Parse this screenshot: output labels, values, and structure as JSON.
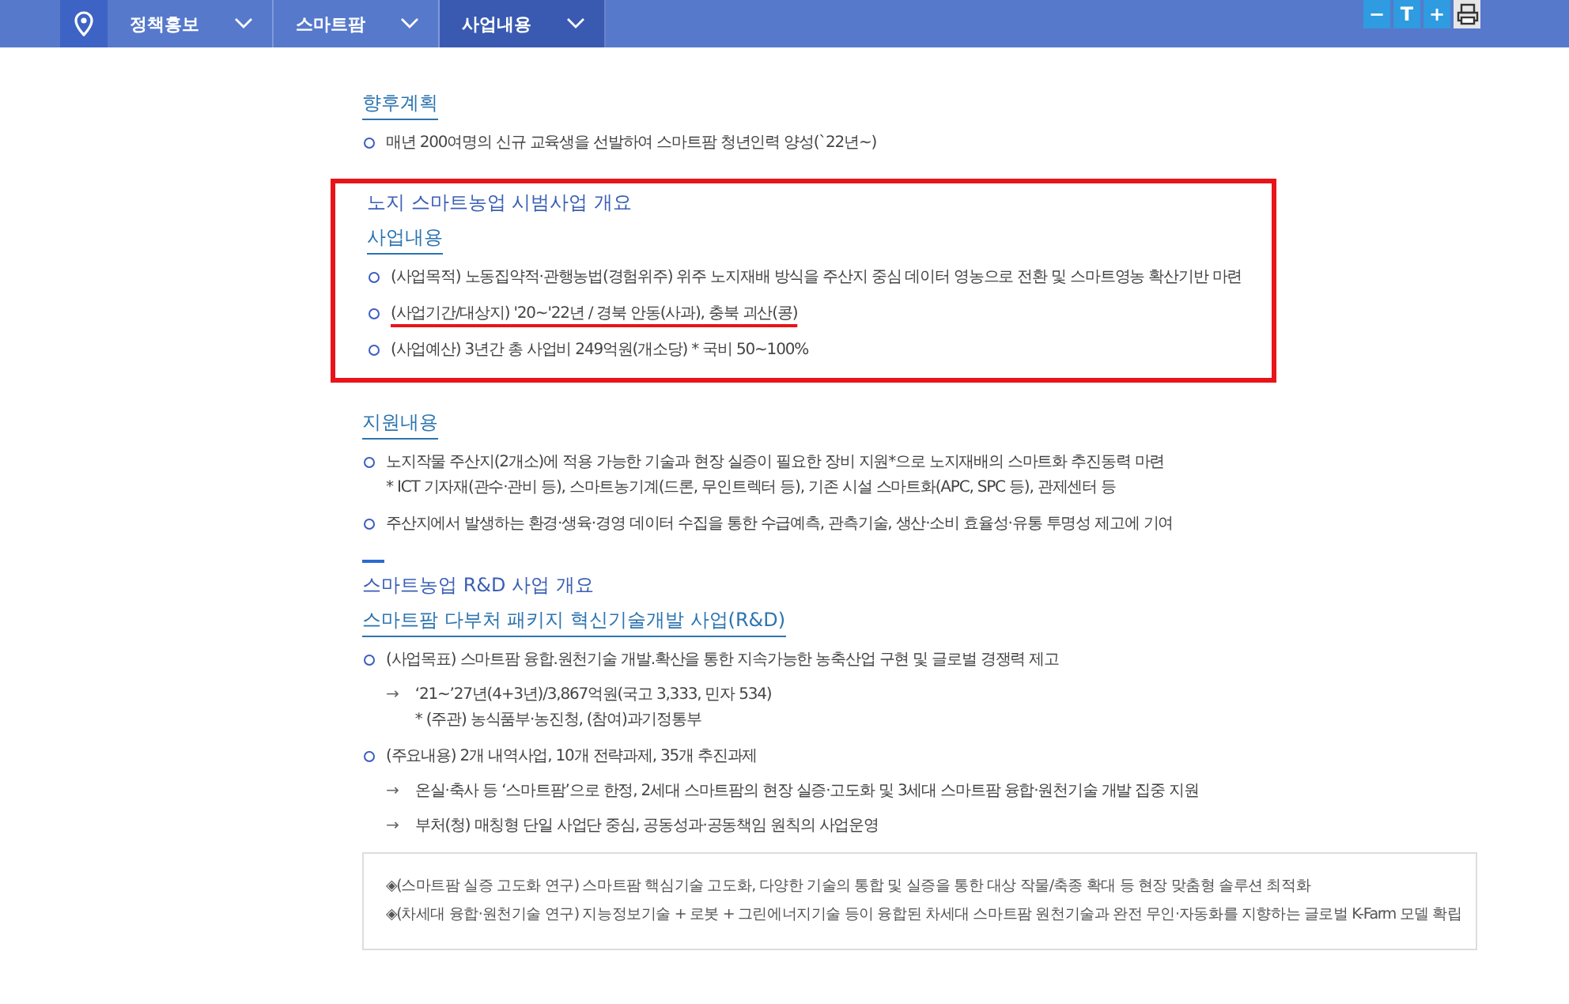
{
  "nav": {
    "items": [
      {
        "label": "정책홍보",
        "selected": false
      },
      {
        "label": "스마트팜",
        "selected": false
      },
      {
        "label": "사업내용",
        "selected": true
      }
    ],
    "tools": [
      {
        "kind": "minus",
        "label": "−"
      },
      {
        "kind": "text",
        "label": "T"
      },
      {
        "kind": "plus",
        "label": "+"
      },
      {
        "kind": "print"
      }
    ]
  },
  "sections": [
    {
      "kind": "plain",
      "heading": "향후계획",
      "items": [
        {
          "text": "매년 200여명의 신규 교육생을 선발하여 스마트팜 청년인력 양성(`22년~)",
          "underlined": false
        }
      ]
    },
    {
      "kind": "highlight",
      "title": "노지 스마트농업 시범사업 개요",
      "heading": "사업내용",
      "items": [
        {
          "text": "(사업목적) 노동집약적·관행농법(경험위주) 위주 노지재배 방식을 주산지 중심 데이터 영농으로 전환 및 스마트영농 확산기반 마련",
          "underlined": false
        },
        {
          "text": "(사업기간/대상지) '20∼'22년 / 경북 안동(사과), 충북 괴산(콩)",
          "underlined": true
        },
        {
          "text": "(사업예산) 3년간 총 사업비 249억원(개소당) * 국비 50∼100%",
          "underlined": false
        }
      ]
    },
    {
      "kind": "plain",
      "heading": "지원내용",
      "items": [
        {
          "text": "노지작물 주산지(2개소)에 적용 가능한 기술과 현장 실증이 필요한 장비 지원*으로 노지재배의 스마트화 추진동력 마련",
          "note": "* ICT 기자재(관수·관비 등), 스마트농기계(드론, 무인트렉터 등), 기존 시설 스마트화(APC, SPC 등), 관제센터 등",
          "underlined": false
        },
        {
          "text": "주산지에서 발생하는 환경·생육·경영 데이터 수집을 통한 수급예측, 관측기술, 생산·소비 효율성·유통 투명성 제고에 기여",
          "underlined": false
        }
      ]
    },
    {
      "kind": "dashed",
      "title": "스마트농업 R&D 사업 개요",
      "heading": "스마트팜 다부처 패키지 혁신기술개발 사업(R&D)",
      "items": [
        {
          "text": "(사업목표) 스마트팜 융합.원천기술 개발.확산을 통한 지속가능한 농축산업 구현 및 글로벌 경쟁력 제고",
          "underlined": false,
          "subs": [
            {
              "mark": "→",
              "text": "‘21~’27년(4+3년)/3,867억원(국고 3,333, 민자 534)",
              "note": "* (주관) 농식품부·농진청, (참여)과기정통부"
            }
          ]
        },
        {
          "text": "(주요내용) 2개 내역사업, 10개 전략과제, 35개 추진과제",
          "underlined": false,
          "subs": [
            {
              "mark": "→",
              "text": "온실·축사 등 ‘스마트팜’으로 한정, 2세대 스마트팜의 현장 실증·고도화 및 3세대 스마트팜 융합·원천기술 개발 집중 지원"
            },
            {
              "mark": "→",
              "text": "부처(청) 매칭형 단일 사업단 중심, 공동성과·공동책임 원칙의 사업운영"
            }
          ]
        }
      ]
    }
  ],
  "box_lines": [
    "◈(스마트팜 실증 고도화 연구) 스마트팜 핵심기술 고도화, 다양한 기술의 통합 및 실증을 통한 대상 작물/축종 확대 등 현장 맞춤형 솔루션 최적화",
    "◈(차세대 융합·원천기술 연구) 지능정보기술 + 로봇 + 그린에너지기술 등이 융합된 차세대 스마트팜 원천기술과 완전 무인·자동화를 지향하는 글로벌 K-Farm 모델 확립"
  ]
}
